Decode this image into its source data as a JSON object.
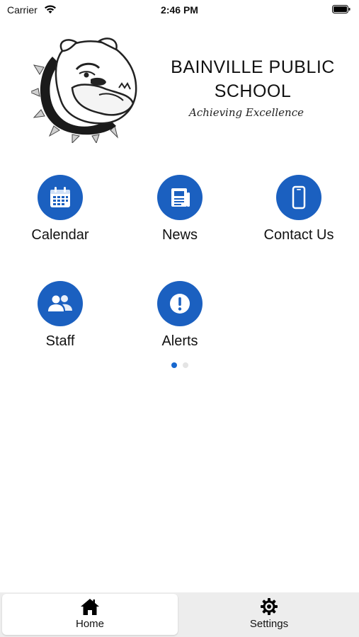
{
  "status_bar": {
    "carrier": "Carrier",
    "time": "2:46 PM"
  },
  "header": {
    "school_name_line1": "BAINVILLE PUBLIC",
    "school_name_line2": "SCHOOL",
    "tagline": "Achieving Excellence",
    "logo_icon": "bulldog-mascot-icon"
  },
  "tiles": [
    {
      "label": "Calendar",
      "icon": "calendar-icon"
    },
    {
      "label": "News",
      "icon": "newspaper-icon"
    },
    {
      "label": "Contact Us",
      "icon": "phone-icon"
    },
    {
      "label": "Staff",
      "icon": "people-icon"
    },
    {
      "label": "Alerts",
      "icon": "alert-icon"
    }
  ],
  "pager": {
    "pages": 2,
    "current": 1
  },
  "tab_bar": {
    "home": {
      "label": "Home",
      "icon": "home-icon"
    },
    "settings": {
      "label": "Settings",
      "icon": "gear-icon"
    }
  },
  "colors": {
    "accent": "#1b60c0",
    "active_dot": "#1767cf",
    "tabbar_bg": "#ededed"
  }
}
